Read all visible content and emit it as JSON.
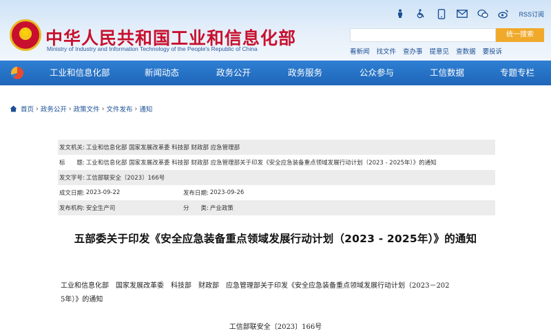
{
  "header": {
    "site_title": "中华人民共和国工业和信息化部",
    "site_subtitle": "Ministry of Industry and Information Technology of the People's Republic of China",
    "rss_label": "RSS订阅",
    "search_button": "统一搜索",
    "search_placeholder": "",
    "quick_links": [
      "看新闻",
      "找文件",
      "查办事",
      "提意见",
      "查数据",
      "要投诉"
    ],
    "top_icons": [
      "accessibility-icon",
      "wheelchair-icon",
      "mobile-icon",
      "mail-icon",
      "wechat-icon",
      "weibo-icon"
    ]
  },
  "nav": {
    "items": [
      "工业和信息化部",
      "新闻动态",
      "政务公开",
      "政务服务",
      "公众参与",
      "工信数据",
      "专题专栏"
    ]
  },
  "breadcrumb": [
    "首页",
    "政务公开",
    "政策文件",
    "文件发布",
    "通知"
  ],
  "info": {
    "issuer_label": "发文机关:",
    "issuer": "工业和信息化部 国家发展改革委 科技部 财政部 应急管理部",
    "title_label": "标　　题:",
    "title": "工业和信息化部 国家发展改革委 科技部 财政部 应急管理部关于印发《安全应急装备重点领域发展行动计划（2023 - 2025年）》的通知",
    "docno_label": "发文字号:",
    "docno": "工信部联安全〔2023〕166号",
    "created_label": "成文日期:",
    "created": "2023-09-22",
    "published_label": "发布日期:",
    "published": "2023-09-26",
    "org_label": "发布机构:",
    "org": "安全生产司",
    "category_label": "分　　类:",
    "category": "产业政策"
  },
  "document": {
    "heading": "五部委关于印发《安全应急装备重点领域发展行动计划（2023 - 2025年）》的通知",
    "body_line1": "工业和信息化部　国家发展改革委　科技部　财政部　应急管理部关于印发《安全应急装备重点领域发展行动计划（2023－202",
    "body_line2": "5年）》的通知",
    "doc_number": "工信部联安全〔2023〕166号"
  },
  "colors": {
    "brand_red": "#c8102e",
    "nav_blue": "#1f66b9",
    "search_orange": "#f0a92a",
    "link_blue": "#1b4f94"
  }
}
